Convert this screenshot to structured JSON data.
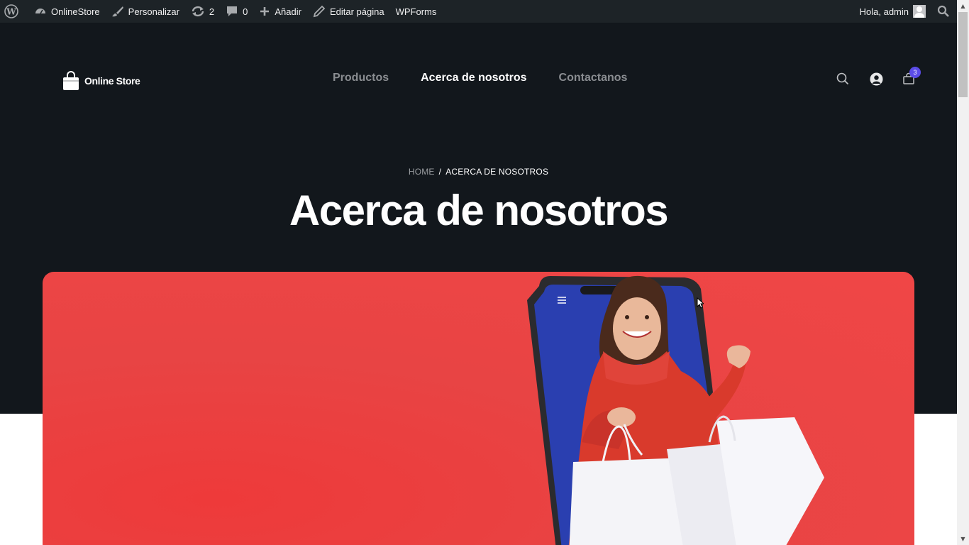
{
  "adminbar": {
    "site_name": "OnlineStore",
    "customize": "Personalizar",
    "updates_count": "2",
    "comments_count": "0",
    "add_new": "Añadir",
    "edit_page": "Editar página",
    "wpforms": "WPForms",
    "greeting": "Hola, admin"
  },
  "header": {
    "logo_text": "Online Store",
    "nav": [
      "Productos",
      "Acerca de nosotros",
      "Contactanos"
    ],
    "active_nav": "Acerca de nosotros",
    "cart_count": "3"
  },
  "breadcrumb": {
    "home": "HOME",
    "separator": "/",
    "current": "ACERCA DE NOSOTROS"
  },
  "page": {
    "title": "Acerca de nosotros"
  },
  "colors": {
    "admin_bar": "#1d2327",
    "hero_bg": "#12171c",
    "banner_red": "#ec4242",
    "badge": "#5b4ce8",
    "phone_screen": "#2a3fb0"
  }
}
